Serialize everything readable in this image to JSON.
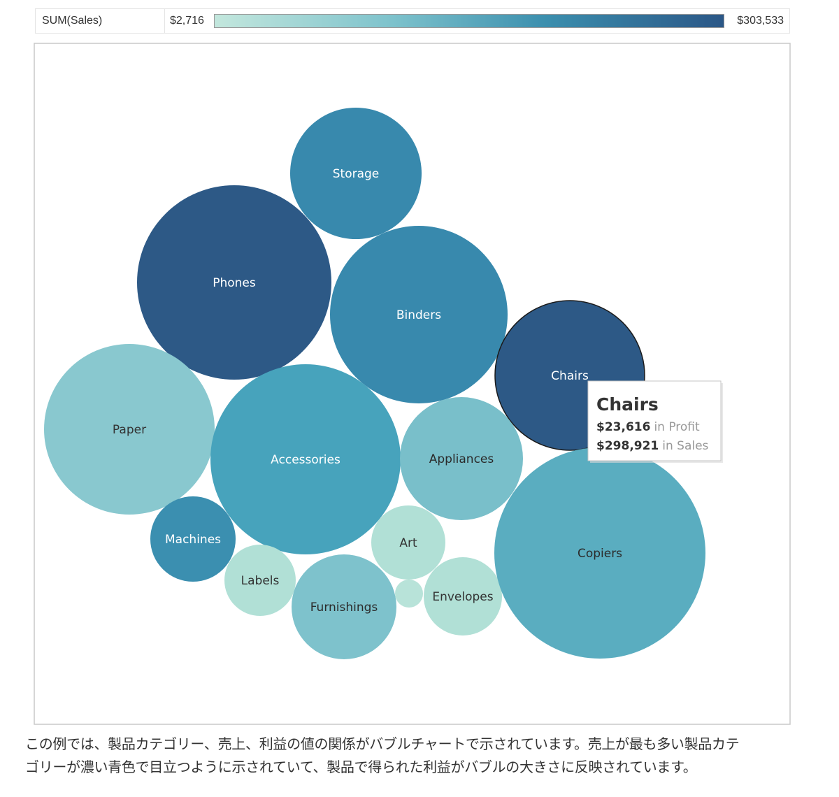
{
  "legend": {
    "label": "SUM(Sales)",
    "min_label": "$2,716",
    "max_label": "$303,533",
    "color_min": "#c3e7dd",
    "color_max": "#2b5787"
  },
  "chart_data": {
    "type": "bubble",
    "measure": "SUM(Sales)",
    "size_encodes": "Profit",
    "color_encodes": "Sales",
    "sales_range": [
      2716,
      303533
    ],
    "categories": [
      {
        "name": "Storage",
        "color": "#3889ad"
      },
      {
        "name": "Phones",
        "color": "#2d5986"
      },
      {
        "name": "Binders",
        "color": "#3889ad"
      },
      {
        "name": "Chairs",
        "color": "#2d5986",
        "profit": 23616,
        "sales": 298921
      },
      {
        "name": "Paper",
        "color": "#89c8cf"
      },
      {
        "name": "Accessories",
        "color": "#47a3bc"
      },
      {
        "name": "Appliances",
        "color": "#79bfca"
      },
      {
        "name": "Machines",
        "color": "#3b8fb0"
      },
      {
        "name": "Labels",
        "color": "#b1e0d6"
      },
      {
        "name": "Art",
        "color": "#b1e0d6"
      },
      {
        "name": "Furnishings",
        "color": "#7ec2cc"
      },
      {
        "name": "",
        "color": "#b8e3d9"
      },
      {
        "name": "Envelopes",
        "color": "#b1e0d6"
      },
      {
        "name": "Copiers",
        "color": "#5aadc0"
      }
    ]
  },
  "tooltip": {
    "title": "Chairs",
    "profit_value": "$23,616",
    "profit_suffix": "in Profit",
    "sales_value": "$298,921",
    "sales_suffix": "in Sales"
  },
  "caption": {
    "line1": "この例では、製品カテゴリー、売上、利益の値の関係がバブルチャートで示されています。売上が最も多い製品カテ",
    "line2": "ゴリーが濃い青色で目立つように示されていて、製品で得られた利益がバブルの大きさに反映されています。"
  }
}
